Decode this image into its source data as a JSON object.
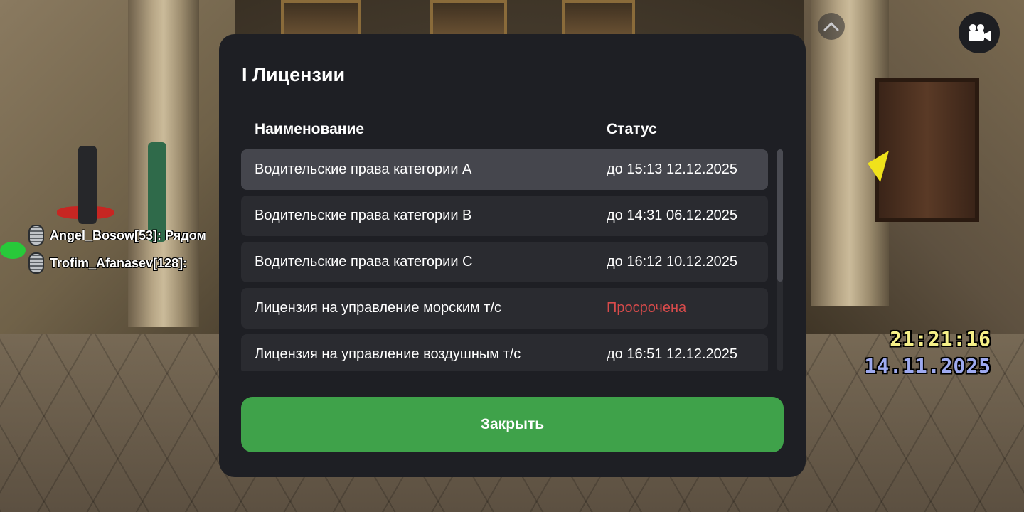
{
  "modal": {
    "title": "I Лицензии",
    "columns": {
      "name": "Наименование",
      "status": "Статус"
    },
    "rows": [
      {
        "name": "Водительские права категории A",
        "status": "до 15:13 12.12.2025",
        "expired": false,
        "selected": true
      },
      {
        "name": "Водительские права категории B",
        "status": "до 14:31 06.12.2025",
        "expired": false,
        "selected": false
      },
      {
        "name": "Водительские права категории C",
        "status": "до 16:12 10.12.2025",
        "expired": false,
        "selected": false
      },
      {
        "name": "Лицензия на управление морским т/с",
        "status": "Просрочена",
        "expired": true,
        "selected": false
      },
      {
        "name": "Лицензия на управление воздушным т/с",
        "status": "до 16:51 12.12.2025",
        "expired": false,
        "selected": false
      }
    ],
    "close_label": "Закрыть"
  },
  "chat": [
    {
      "text": "Angel_Bosow[53]: Рядом"
    },
    {
      "text": "Trofim_Afanasev[128]:"
    }
  ],
  "hud": {
    "time": "21:21:16",
    "date": "14.11.2025"
  },
  "icons": {
    "up": "chevron-up-icon",
    "camera": "video-camera-icon",
    "mic": "microphone-icon"
  },
  "colors": {
    "modal_bg": "#1e1f24",
    "row_bg": "#2a2b30",
    "row_selected_bg": "#45464d",
    "expired": "#d94b4b",
    "close_button": "#3fa24a",
    "time": "#f6f088",
    "date": "#9eaaf0"
  }
}
